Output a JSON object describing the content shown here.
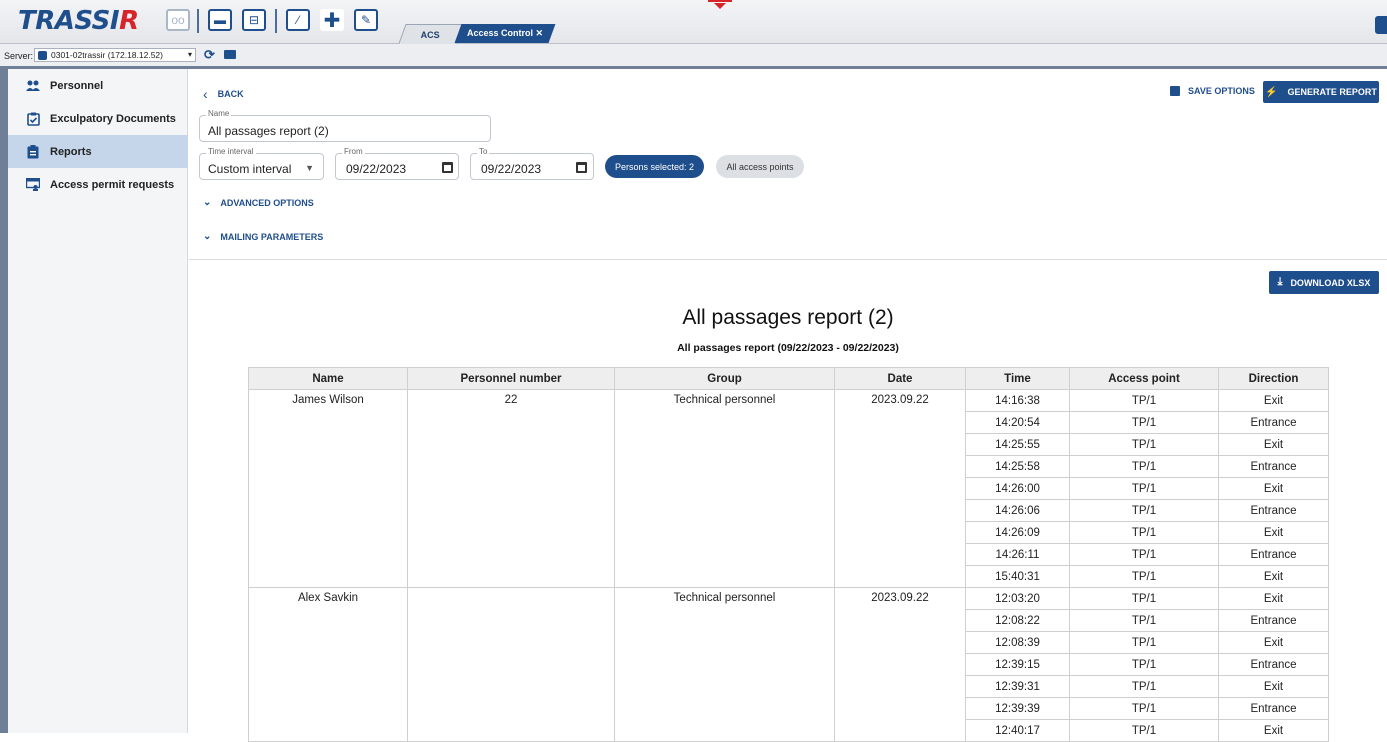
{
  "app": {
    "logo_main": "TRASSI",
    "logo_accent": "R",
    "tabs": [
      {
        "label": "ACS"
      },
      {
        "label": "Access Control ✕"
      }
    ]
  },
  "server": {
    "label": "Server:",
    "value": "0301-02trassir (172.18.12.52)"
  },
  "sidebar": {
    "items": [
      {
        "label": "Personnel",
        "icon": "people-icon"
      },
      {
        "label": "Exculpatory Documents",
        "icon": "clipboard-check-icon"
      },
      {
        "label": "Reports",
        "icon": "report-icon"
      },
      {
        "label": "Access permit requests",
        "icon": "permit-icon"
      }
    ],
    "active_index": 2
  },
  "header": {
    "back_label": "BACK",
    "save_options_label": "SAVE OPTIONS",
    "generate_label": "GENERATE REPORT"
  },
  "form": {
    "name_label": "Name",
    "name_value": "All passages report (2)",
    "interval_label": "Time interval",
    "interval_value": "Custom interval",
    "from_label": "From",
    "from_value": "09/22/2023",
    "to_label": "To",
    "to_value": "09/22/2023",
    "persons_chip": "Persons selected: 2",
    "access_points_chip": "All access points",
    "advanced_label": "ADVANCED OPTIONS",
    "mailing_label": "MAILING PARAMETERS"
  },
  "report": {
    "download_label": "DOWNLOAD XLSX",
    "title": "All passages report (2)",
    "subtitle": "All passages report (09/22/2023 - 09/22/2023)",
    "columns": [
      "Name",
      "Personnel number",
      "Group",
      "Date",
      "Time",
      "Access point",
      "Direction"
    ],
    "groups": [
      {
        "name": "James Wilson",
        "number": "22",
        "group": "Technical personnel",
        "date": "2023.09.22",
        "rows": [
          {
            "time": "14:16:38",
            "point": "TP/1",
            "direction": "Exit"
          },
          {
            "time": "14:20:54",
            "point": "TP/1",
            "direction": "Entrance"
          },
          {
            "time": "14:25:55",
            "point": "TP/1",
            "direction": "Exit"
          },
          {
            "time": "14:25:58",
            "point": "TP/1",
            "direction": "Entrance"
          },
          {
            "time": "14:26:00",
            "point": "TP/1",
            "direction": "Exit"
          },
          {
            "time": "14:26:06",
            "point": "TP/1",
            "direction": "Entrance"
          },
          {
            "time": "14:26:09",
            "point": "TP/1",
            "direction": "Exit"
          },
          {
            "time": "14:26:11",
            "point": "TP/1",
            "direction": "Entrance"
          },
          {
            "time": "15:40:31",
            "point": "TP/1",
            "direction": "Exit"
          }
        ]
      },
      {
        "name": "Alex Savkin",
        "number": "",
        "group": "Technical personnel",
        "date": "2023.09.22",
        "rows": [
          {
            "time": "12:03:20",
            "point": "TP/1",
            "direction": "Exit"
          },
          {
            "time": "12:08:22",
            "point": "TP/1",
            "direction": "Entrance"
          },
          {
            "time": "12:08:39",
            "point": "TP/1",
            "direction": "Exit"
          },
          {
            "time": "12:39:15",
            "point": "TP/1",
            "direction": "Entrance"
          },
          {
            "time": "12:39:31",
            "point": "TP/1",
            "direction": "Exit"
          },
          {
            "time": "12:39:39",
            "point": "TP/1",
            "direction": "Entrance"
          },
          {
            "time": "12:40:17",
            "point": "TP/1",
            "direction": "Exit"
          }
        ]
      }
    ]
  },
  "colors": {
    "accent": "#1f4e8c",
    "brand_red": "#d6242a",
    "active_row": "#c5d6ea"
  }
}
